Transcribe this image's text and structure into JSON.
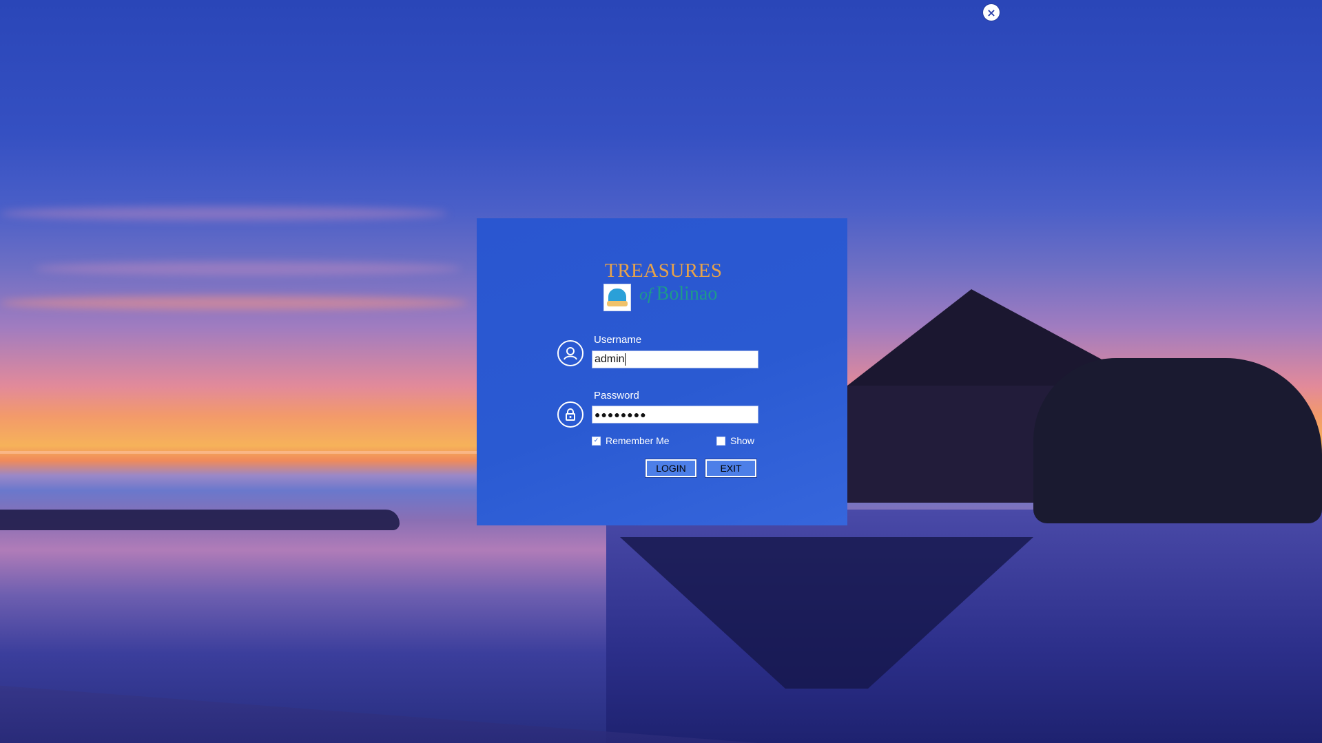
{
  "window": {
    "close_symbol": "×"
  },
  "logo": {
    "title": "TREASURES",
    "of": "of",
    "place": "Bolinao"
  },
  "form": {
    "username_label": "Username",
    "username_value": "admin",
    "password_label": "Password",
    "password_value": "●●●●●●●●",
    "remember_label": "Remember Me",
    "remember_checked": true,
    "show_label": "Show",
    "show_checked": false,
    "login_label": "LOGIN",
    "exit_label": "EXIT"
  },
  "colors": {
    "dialog": "#2a56d0",
    "logo_title": "#e6a24a",
    "logo_subtitle": "#1e9a8a"
  },
  "icons": {
    "username": "user-circle-icon",
    "password": "lock-icon",
    "close": "close-icon"
  }
}
